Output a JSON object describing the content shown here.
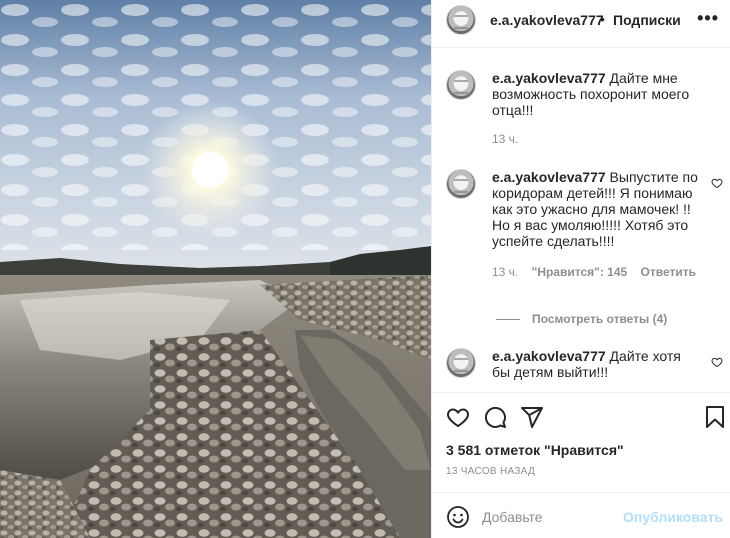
{
  "header": {
    "username": "e.a.yakovleva777",
    "separator": "•",
    "follow_label": "Подписки",
    "more_label": "•••"
  },
  "comments": [
    {
      "username": "e.a.yakovleva777",
      "text": "Дайте мне возможность похоронит моего отца!!!",
      "time": "13 ч."
    },
    {
      "username": "e.a.yakovleva777",
      "text": "Выпустите по коридорам детей!!! Я понимаю как это ужасно для мамочек! !! Но я вас умоляю!!!!! Хотяб это успейте сделать!!!!",
      "time": "13 ч.",
      "likes": "\"Нравится\": 145",
      "reply_label": "Ответить"
    },
    {
      "username": "e.a.yakovleva777",
      "text": "Дайте хотя бы детям выйти!!!"
    }
  ],
  "view_replies": "Посмотреть ответы (4)",
  "post": {
    "likes": "3 581 отметок \"Нравится\"",
    "time": "13 ЧАСОВ НАЗАД"
  },
  "add_comment": {
    "placeholder": "Добавьте",
    "publish_label": "Опубликовать"
  },
  "icons": {
    "heart": "heart-icon",
    "comment": "comment-icon",
    "share": "share-icon",
    "bookmark": "bookmark-icon",
    "emoji": "emoji-icon"
  },
  "colors": {
    "accent_disabled": "#b2dffc",
    "muted": "#8e8e8e",
    "text": "#262626"
  }
}
